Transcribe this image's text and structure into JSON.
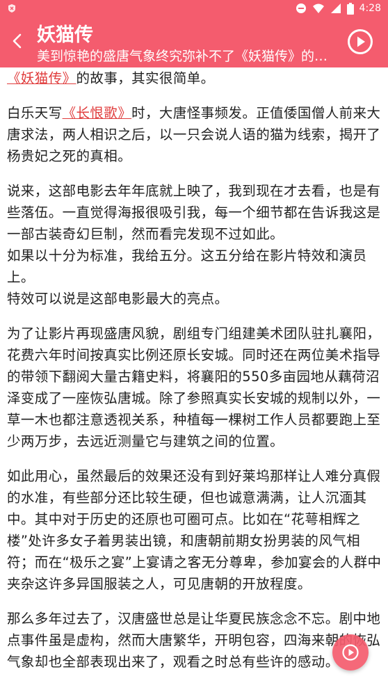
{
  "status_bar": {
    "time": "4:28"
  },
  "header": {
    "title": "妖猫传",
    "subtitle": "美到惊艳的盛唐气象终究弥补不了《妖猫传》的遗憾"
  },
  "article": {
    "p1": {
      "link": "《妖猫传》",
      "text": "的故事，其实很简单。"
    },
    "p2": {
      "before": "白乐天写",
      "link": "《长恨歌》",
      "after": "时，大唐怪事频发。正值倭国僧人前来大唐求法，两人相识之后，以一只会说人语的猫为线索，揭开了杨贵妃之死的真相。"
    },
    "p3a": "说来，这部电影去年年底就上映了，我到现在才去看，也是有些落伍。一直觉得海报很吸引我，每一个细节都在告诉我这是一部古装奇幻巨制，然而看完发现不过如此。",
    "p3b": "如果以十分为标准，我给五分。这五分给在影片特效和演员上。",
    "p3c": "特效可以说是这部电影最大的亮点。",
    "p4": "为了让影片再现盛唐风貌，剧组专门组建美术团队驻扎襄阳，花费六年时间按真实比例还原长安城。同时还在两位美术指导的带领下翻阅大量古籍史料，将襄阳的550多亩园地从藕荷沼泽变成了一座恢弘唐城。除了参照真实长安城的规制以外，一草一木也都注意透视关系，种植每一棵树工作人员都要跑上至少两万步，去远近测量它与建筑之间的位置。",
    "p5": "如此用心，虽然最后的效果还没有到好莱坞那样让人难分真假的水准，有些部分还比较生硬，但也诚意满满，让人沉湎其中。其中对于历史的还原也可圈可点。比如在“花萼相辉之楼”处许多女子着男装出镜，和唐朝前期女扮男装的风气相符；而在“极乐之宴”上宴请之客无分尊卑，参加宴会的人群中夹杂这许多异国服装之人，可见唐朝的开放程度。",
    "p6": "那么多年过去了，汉唐盛世总是让华夏民族念念不忘。剧中地点事件虽是虚构，然而大唐繁华，开明包容，四海来朝的恢弘气象却也全部表现出来了，观看之时总有些许的感动。"
  }
}
